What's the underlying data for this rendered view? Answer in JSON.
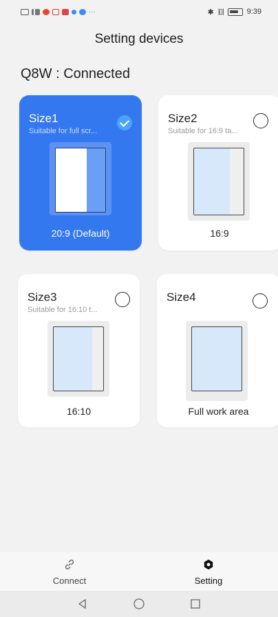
{
  "status_bar": {
    "time": "9:39",
    "left_icons": [
      "hd-icon",
      "signal-icon",
      "weibo-icon",
      "app-icon",
      "mail-icon",
      "dot-icon",
      "chat-icon",
      "more-dots-icon"
    ],
    "right_icons": [
      "bluetooth-icon",
      "vibrate-icon",
      "battery-icon"
    ]
  },
  "header": {
    "title": "Setting devices"
  },
  "device": {
    "status": "Q8W : Connected"
  },
  "sizes": [
    {
      "title": "Size1",
      "subtitle": "Suitable for full scr...",
      "ratio": "20:9 (Default)",
      "selected": true
    },
    {
      "title": "Size2",
      "subtitle": "Suitable for 16:9 ta...",
      "ratio": "16:9",
      "selected": false
    },
    {
      "title": "Size3",
      "subtitle": "Suitable for 16:10 t...",
      "ratio": "16:10",
      "selected": false
    },
    {
      "title": "Size4",
      "subtitle": "",
      "ratio": "Full work area",
      "selected": false
    }
  ],
  "bottom_nav": {
    "items": [
      {
        "label": "Connect",
        "icon": "link-icon",
        "active": false
      },
      {
        "label": "Setting",
        "icon": "gear-icon",
        "active": true
      }
    ]
  },
  "system_nav": [
    "back-icon",
    "home-icon",
    "recents-icon"
  ],
  "colors": {
    "accent": "#3478f0",
    "check": "#4aa3ff",
    "background": "#f2f2f3",
    "preview_fill": "#d7e8fb"
  }
}
